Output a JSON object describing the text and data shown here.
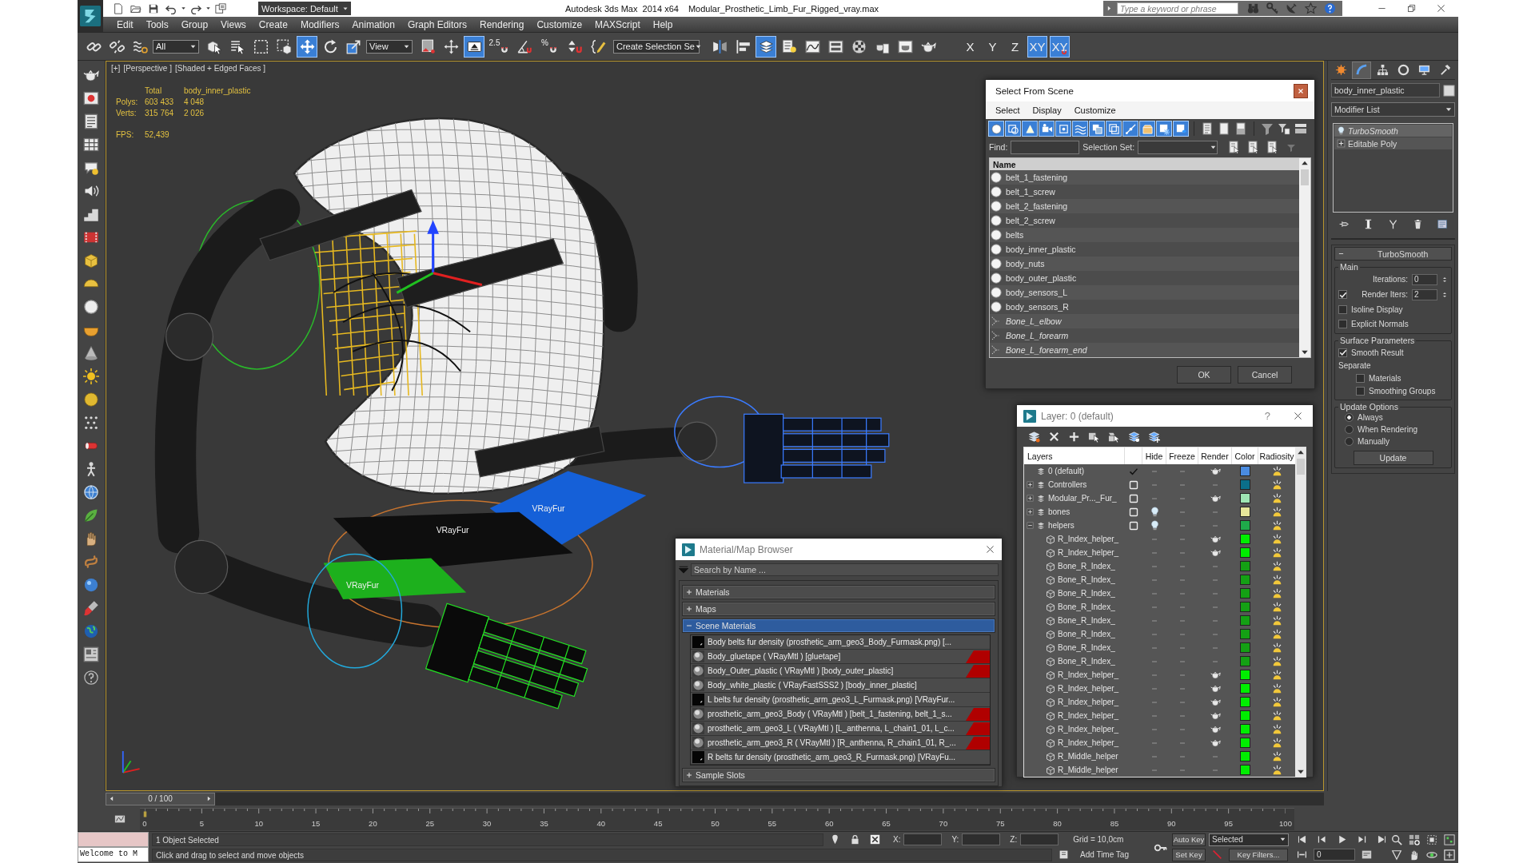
{
  "title_bar": {
    "workspace": "Workspace: Default",
    "app_name": "Autodesk 3ds Max  2014 x64",
    "file_name": "Modular_Prosthetic_Limb_Fur_Rigged_vray.max",
    "search": {
      "placeholder": "Type a keyword or phrase"
    }
  },
  "menu_bar": [
    "Edit",
    "Tools",
    "Group",
    "Views",
    "Create",
    "Modifiers",
    "Animation",
    "Graph Editors",
    "Rendering",
    "Customize",
    "MAXScript",
    "Help"
  ],
  "main_toolbar": [
    {
      "kind": "link",
      "selected": false
    },
    {
      "kind": "unlink",
      "selected": false
    },
    {
      "kind": "bind",
      "selected": false
    },
    {
      "kind": "filter-dropdown",
      "value": "All"
    },
    {
      "kind": "select",
      "selected": false
    },
    {
      "kind": "select-by-name",
      "selected": false
    },
    {
      "kind": "selection-region",
      "selected": false
    },
    {
      "kind": "window-crossing",
      "selected": false
    },
    {
      "kind": "move",
      "selected": true
    },
    {
      "kind": "rotate",
      "selected": false
    },
    {
      "kind": "scale",
      "selected": false
    },
    {
      "kind": "coordinate-dropdown",
      "value": "View"
    },
    {
      "kind": "pivot-center",
      "selected": false
    },
    {
      "kind": "manipulate",
      "selected": false
    },
    {
      "kind": "keyboard-override",
      "selected": true
    },
    {
      "kind": "snap",
      "label": "2.5",
      "selected": false
    },
    {
      "kind": "angle-snap",
      "selected": false
    },
    {
      "kind": "snap",
      "label": "%",
      "selected": false
    },
    {
      "kind": "spinner-snap",
      "selected": false
    },
    {
      "kind": "named-selection",
      "selected": false
    },
    {
      "kind": "selection-set-dropdown",
      "value": "Create Selection Se"
    },
    {
      "kind": "mirror",
      "selected": false
    },
    {
      "kind": "align",
      "selected": false
    },
    {
      "kind": "layer-manager",
      "selected": true
    },
    {
      "kind": "scene-explorer",
      "selected": false
    },
    {
      "kind": "curve-editor",
      "selected": false
    },
    {
      "kind": "schematic-view",
      "selected": false
    },
    {
      "kind": "material-editor",
      "selected": false
    },
    {
      "kind": "render-setup",
      "selected": false
    },
    {
      "kind": "render-frame",
      "selected": false
    },
    {
      "kind": "render",
      "selected": false
    },
    {
      "kind": "axis",
      "label": "X",
      "selected": false
    },
    {
      "kind": "axis",
      "label": "Y",
      "selected": false
    },
    {
      "kind": "axis",
      "label": "Z",
      "selected": false
    },
    {
      "kind": "axis",
      "label": "XY",
      "selected": true
    },
    {
      "kind": "axis-snap",
      "label": "XY",
      "selected": true
    }
  ],
  "side_toolbar": [
    {
      "kind": "teapot"
    },
    {
      "kind": "picture"
    },
    {
      "kind": "list"
    },
    {
      "kind": "grid"
    },
    {
      "kind": "bubble"
    },
    {
      "kind": "sound"
    },
    {
      "kind": "steps"
    },
    {
      "kind": "film"
    },
    {
      "kind": "box"
    },
    {
      "kind": "hemisphere"
    },
    {
      "kind": "sphere"
    },
    {
      "kind": "bowl"
    },
    {
      "kind": "cone"
    },
    {
      "kind": "sun"
    },
    {
      "kind": "disc"
    },
    {
      "kind": "dots"
    },
    {
      "kind": "tube"
    },
    {
      "kind": "figure"
    },
    {
      "kind": "globe"
    },
    {
      "kind": "leaf"
    },
    {
      "kind": "hand"
    },
    {
      "kind": "knot"
    },
    {
      "kind": "ball"
    },
    {
      "kind": "brush"
    },
    {
      "kind": "earth"
    },
    {
      "kind": "panel"
    },
    {
      "kind": "help"
    }
  ],
  "viewport": {
    "labels": [
      "[+]",
      "[Perspective ]",
      "[Shaded + Edged Faces ]"
    ],
    "stats": {
      "columns": [
        "Total",
        "body_inner_plastic"
      ],
      "rows": [
        {
          "label": "Polys:",
          "values": [
            "603 433",
            "4 048"
          ]
        },
        {
          "label": "Verts:",
          "values": [
            "315 764",
            "2 026"
          ]
        }
      ],
      "fps_label": "FPS:",
      "fps": "52,439"
    },
    "object_labels": [
      "VRayFur",
      "VRayFur",
      "VRayFur"
    ]
  },
  "select_from_scene": {
    "title": "Select From Scene",
    "menu": [
      "Select",
      "Display",
      "Customize"
    ],
    "filters": [
      {
        "kind": "geometry",
        "selected": true
      },
      {
        "kind": "shapes",
        "selected": true
      },
      {
        "kind": "lights",
        "selected": true
      },
      {
        "kind": "cameras",
        "selected": true
      },
      {
        "kind": "helpers",
        "selected": true
      },
      {
        "kind": "warps",
        "selected": true
      },
      {
        "kind": "groups",
        "selected": true
      },
      {
        "kind": "xrefs",
        "selected": true
      },
      {
        "kind": "bones",
        "selected": true
      },
      {
        "kind": "containers",
        "selected": true
      },
      {
        "kind": "frozen",
        "selected": true
      },
      {
        "kind": "hidden",
        "selected": true
      }
    ],
    "find_label": "Find:",
    "selection_set_label": "Selection Set:",
    "column": "Name",
    "rows": [
      {
        "name": "belt_1_fastening",
        "kind": "geometry"
      },
      {
        "name": "belt_1_screw",
        "kind": "geometry"
      },
      {
        "name": "belt_2_fastening",
        "kind": "geometry"
      },
      {
        "name": "belt_2_screw",
        "kind": "geometry"
      },
      {
        "name": "belts",
        "kind": "geometry"
      },
      {
        "name": "body_inner_plastic",
        "kind": "geometry"
      },
      {
        "name": "body_nuts",
        "kind": "geometry"
      },
      {
        "name": "body_outer_plastic",
        "kind": "geometry"
      },
      {
        "name": "body_sensors_L",
        "kind": "geometry"
      },
      {
        "name": "body_sensors_R",
        "kind": "geometry"
      },
      {
        "name": "Bone_L_elbow",
        "kind": "bone"
      },
      {
        "name": "Bone_L_forearm",
        "kind": "bone"
      },
      {
        "name": "Bone_L_forearm_end",
        "kind": "bone"
      }
    ],
    "buttons": [
      "OK",
      "Cancel"
    ]
  },
  "layer_dialog": {
    "title": "Layer: 0 (default)",
    "help": "?",
    "columns": [
      "Layers",
      "Hide",
      "Freeze",
      "Render",
      "Color",
      "Radiosity"
    ],
    "layers": [
      {
        "name": "0 (default)",
        "current": true,
        "hidden": false,
        "frozen": false,
        "renderable": true,
        "color": "#4a8be0"
      },
      {
        "name": "Controllers",
        "expanded": false,
        "current": false,
        "hidden": false,
        "frozen": false,
        "renderable": false,
        "color": "#0b6f8a"
      },
      {
        "name": "Modular_Pr..._Fur_",
        "expanded": false,
        "current": false,
        "hidden": false,
        "frozen": false,
        "renderable": true,
        "color": "#9fe6b4"
      },
      {
        "name": "bones",
        "expanded": false,
        "current": false,
        "hidden": true,
        "frozen": false,
        "renderable": false,
        "color": "#e6e69a"
      },
      {
        "name": "helpers",
        "expanded": true,
        "current": false,
        "hidden": true,
        "frozen": false,
        "renderable": false,
        "color": "#1faa4a",
        "children": [
          {
            "name": "R_Index_helper_",
            "hidden": false,
            "frozen": false,
            "renderable": true,
            "color": "#00ee00"
          },
          {
            "name": "R_Index_helper_",
            "hidden": false,
            "frozen": false,
            "renderable": true,
            "color": "#00ee00"
          },
          {
            "name": "Bone_R_Index_",
            "hidden": false,
            "frozen": false,
            "renderable": false,
            "color": "#14a014"
          },
          {
            "name": "Bone_R_Index_",
            "hidden": false,
            "frozen": false,
            "renderable": false,
            "color": "#14a014"
          },
          {
            "name": "Bone_R_Index_",
            "hidden": false,
            "frozen": false,
            "renderable": false,
            "color": "#14a014"
          },
          {
            "name": "Bone_R_Index_",
            "hidden": false,
            "frozen": false,
            "renderable": false,
            "color": "#14a014"
          },
          {
            "name": "Bone_R_Index_",
            "hidden": false,
            "frozen": false,
            "renderable": false,
            "color": "#14a014"
          },
          {
            "name": "Bone_R_Index_",
            "hidden": false,
            "frozen": false,
            "renderable": false,
            "color": "#14a014"
          },
          {
            "name": "Bone_R_Index_",
            "hidden": false,
            "frozen": false,
            "renderable": false,
            "color": "#14a014"
          },
          {
            "name": "Bone_R_Index_",
            "hidden": false,
            "frozen": false,
            "renderable": false,
            "color": "#14a014"
          },
          {
            "name": "R_Index_helper_",
            "hidden": false,
            "frozen": false,
            "renderable": true,
            "color": "#00ee00"
          },
          {
            "name": "R_Index_helper_",
            "hidden": false,
            "frozen": false,
            "renderable": true,
            "color": "#00ee00"
          },
          {
            "name": "R_Index_helper_",
            "hidden": false,
            "frozen": false,
            "renderable": true,
            "color": "#00ee00"
          },
          {
            "name": "R_Index_helper_",
            "hidden": false,
            "frozen": false,
            "renderable": true,
            "color": "#00ee00"
          },
          {
            "name": "R_Index_helper_",
            "hidden": false,
            "frozen": false,
            "renderable": true,
            "color": "#00ee00"
          },
          {
            "name": "R_Index_helper_",
            "hidden": false,
            "frozen": false,
            "renderable": true,
            "color": "#00ee00"
          },
          {
            "name": "R_Middle_helper",
            "hidden": false,
            "frozen": false,
            "renderable": false,
            "color": "#00ee00"
          },
          {
            "name": "R_Middle_helper",
            "hidden": false,
            "frozen": false,
            "renderable": false,
            "color": "#00ee00"
          }
        ]
      }
    ]
  },
  "material_browser": {
    "title": "Material/Map Browser",
    "search": {
      "placeholder": "Search by Name ..."
    },
    "groups": [
      {
        "label": "Materials",
        "expanded": false,
        "selected": false
      },
      {
        "label": "Maps",
        "expanded": false,
        "selected": false
      },
      {
        "label": "Scene Materials",
        "expanded": true,
        "selected": true,
        "items": [
          {
            "name": "Body belts fur density (prosthetic_arm_geo3_Body_Furmask.png) [...",
            "kind": "map",
            "flagged": false
          },
          {
            "name": "Body_gluetape ( VRayMtl ) [gluetape]",
            "kind": "material",
            "flagged": true
          },
          {
            "name": "Body_Outer_plastic ( VRayMtl ) [body_outer_plastic]",
            "kind": "material",
            "flagged": true
          },
          {
            "name": "Body_white_plastic ( VRayFastSSS2 ) [body_inner_plastic]",
            "kind": "material",
            "flagged": false
          },
          {
            "name": "L belts fur density (prosthetic_arm_geo3_L_Furmask.png) [VRayFur...",
            "kind": "map",
            "flagged": false
          },
          {
            "name": "prosthetic_arm_geo3_Body ( VRayMtl ) [belt_1_fastening, belt_1_s...",
            "kind": "material",
            "flagged": true
          },
          {
            "name": "prosthetic_arm_geo3_L ( VRayMtl ) [L_anthenna, L_chain1_01, L_c...",
            "kind": "material",
            "flagged": true
          },
          {
            "name": "prosthetic_arm_geo3_R ( VRayMtl ) [R_anthenna, R_chain1_01, R_...",
            "kind": "material",
            "flagged": true
          },
          {
            "name": "R belts fur density (prosthetic_arm_geo3_R_Furmask.png) [VRayFu...",
            "kind": "map",
            "flagged": false
          }
        ]
      },
      {
        "label": "Sample Slots",
        "expanded": false,
        "selected": false
      }
    ]
  },
  "command_panel": {
    "tabs": [
      {
        "kind": "create",
        "selected": false
      },
      {
        "kind": "modify",
        "selected": true
      },
      {
        "kind": "hierarchy",
        "selected": false
      },
      {
        "kind": "motion",
        "selected": false
      },
      {
        "kind": "display",
        "selected": false
      },
      {
        "kind": "utilities",
        "selected": false
      }
    ],
    "object_name": "body_inner_plastic",
    "modifier_list": "Modifier List",
    "stack": [
      {
        "name": "TurboSmooth",
        "kind": "modifier",
        "selected": true
      },
      {
        "name": "Editable Poly",
        "kind": "base-object",
        "selected": false
      }
    ],
    "rollout": {
      "title": "TurboSmooth",
      "expanded": true,
      "groups": [
        {
          "title": "Main",
          "controls": [
            {
              "kind": "spinner",
              "label": "Iterations:",
              "value": "0"
            },
            {
              "kind": "check-spinner",
              "label": "Render Iters:",
              "value": "2",
              "checked": true
            },
            {
              "kind": "checkbox",
              "label": "Isoline Display",
              "checked": false
            },
            {
              "kind": "checkbox",
              "label": "Explicit Normals",
              "checked": false
            }
          ]
        },
        {
          "title": "Surface Parameters",
          "controls": [
            {
              "kind": "checkbox",
              "label": "Smooth Result",
              "checked": true
            },
            {
              "kind": "label",
              "label": "Separate",
              "children": [
                {
                  "kind": "checkbox",
                  "label": "Materials",
                  "checked": false
                },
                {
                  "kind": "checkbox",
                  "label": "Smoothing Groups",
                  "checked": false
                }
              ]
            }
          ]
        },
        {
          "title": "Update Options",
          "controls": [
            {
              "kind": "radio",
              "label": "Always",
              "selected": true
            },
            {
              "kind": "radio",
              "label": "When Rendering",
              "selected": false
            },
            {
              "kind": "radio",
              "label": "Manually",
              "selected": false
            },
            {
              "kind": "button",
              "label": "Update"
            }
          ]
        }
      ]
    }
  },
  "timeline": {
    "slider": "0 / 100",
    "level": 0,
    "ticks": [
      "0",
      "5",
      "10",
      "15",
      "20",
      "25",
      "30",
      "35",
      "40",
      "45",
      "50",
      "55",
      "60",
      "65",
      "70",
      "75",
      "80",
      "85",
      "90",
      "95",
      "100"
    ]
  },
  "status_bar": {
    "listener_output": "Welcome to M",
    "selection": "1 Object Selected",
    "prompt": "Click and drag to select and move objects",
    "coords": [
      {
        "label": "X:"
      },
      {
        "label": "Y:"
      },
      {
        "label": "Z:"
      }
    ],
    "grid": "Grid = 10,0cm",
    "time_tag": "Add Time Tag",
    "auto_key": "Auto Key",
    "key_mode": "Selected",
    "set_key": "Set Key",
    "key_filters": "Key Filters...",
    "frame": "0"
  }
}
